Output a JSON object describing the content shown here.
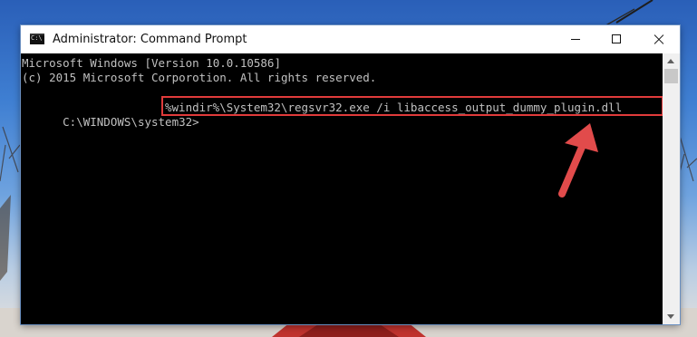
{
  "window": {
    "title": "Administrator: Command Prompt",
    "icon": "cmd-icon"
  },
  "controls": {
    "minimize_icon": "minimize-icon",
    "maximize_icon": "maximize-icon",
    "close_icon": "close-icon"
  },
  "console": {
    "line1": "Microsoft Windows [Version 10.0.10586]",
    "line2": "(c) 2015 Microsoft Corporotion. All rights reserved.",
    "prompt": "C:\\WINDOWS\\system32>",
    "command": "%windir%\\System32\\regsvr32.exe /i libaccess_output_dummy_plugin.dll"
  },
  "colors": {
    "console_bg": "#000000",
    "console_text": "#c0c0c0",
    "highlight": "#e13b3b",
    "arrow": "#e14b4b"
  }
}
